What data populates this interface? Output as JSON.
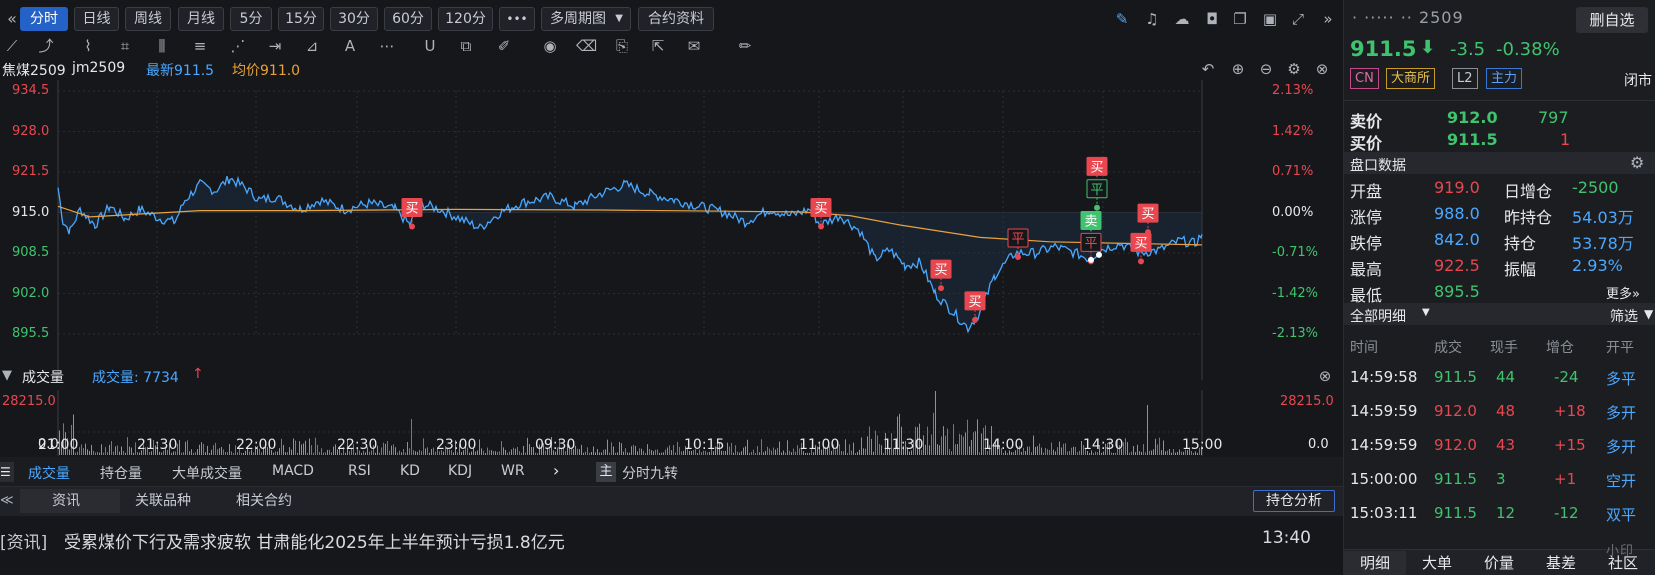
{
  "toolbar": {
    "tabs": [
      "分时",
      "日线",
      "周线",
      "月线",
      "5分",
      "15分",
      "30分",
      "60分",
      "120分"
    ],
    "more": "•••",
    "multi_period": "多周期图",
    "contract_info": "合约资料"
  },
  "chart_header": {
    "symbol": "焦煤2509",
    "code": "jm2509",
    "latest_label": "最新911.5",
    "avg_label": "均价911.0"
  },
  "price_axis_left": [
    "934.5",
    "928.0",
    "921.5",
    "915.0",
    "908.5",
    "902.0",
    "895.5"
  ],
  "price_axis_right": [
    "2.13%",
    "1.42%",
    "0.71%",
    "0.00%",
    "-0.71%",
    "-1.42%",
    "-2.13%"
  ],
  "volume_panel": {
    "title": "成交量",
    "value_label": "成交量: 7734",
    "max_left": "28215.0",
    "min_left": "0.0",
    "max_right": "28215.0",
    "min_right": "0.0"
  },
  "time_axis": [
    "21:00",
    "21:30",
    "22:00",
    "22:30",
    "23:00",
    "09:30",
    "10:15",
    "11:00",
    "11:30",
    "14:00",
    "14:30",
    "15:00"
  ],
  "trade_marks": [
    "买",
    "买",
    "买",
    "买",
    "买",
    "平",
    "买",
    "卖",
    "平",
    "平",
    "买",
    "买"
  ],
  "indicator_tabs": [
    "成交量",
    "持仓量",
    "大单成交量",
    "MACD",
    "RSI",
    "KD",
    "KDJ",
    "WR"
  ],
  "indicator_extra": {
    "badge": "主",
    "label": "分时九转"
  },
  "news_tabs": [
    "资讯",
    "关联品种",
    "相关合约"
  ],
  "news_button": "持仓分析",
  "news": {
    "tag": "[资讯]",
    "headline": "受累煤价下行及需求疲软 甘肃能化2025年上半年预计亏损1.8亿元",
    "time": "13:40"
  },
  "quote": {
    "name_masked": "· ·····   ·· 2509",
    "remove_button": "删自选",
    "price": "911.5",
    "change": "-3.5",
    "change_pct": "-0.38%",
    "badges": [
      "CN",
      "大商所",
      "L2",
      "主力"
    ],
    "status": "闭市",
    "ask_label": "卖价",
    "ask_price": "912.0",
    "ask_vol": "797",
    "bid_label": "买价",
    "bid_price": "911.5",
    "bid_vol": "1"
  },
  "panel_title": "盘口数据",
  "stats": [
    {
      "l1": "开盘",
      "v1": "919.0",
      "l2": "日增仓",
      "v2": "-2500"
    },
    {
      "l1": "涨停",
      "v1": "988.0",
      "l2": "昨持仓",
      "v2": "54.03万"
    },
    {
      "l1": "跌停",
      "v1": "842.0",
      "l2": "持仓",
      "v2": "53.78万"
    },
    {
      "l1": "最高",
      "v1": "922.5",
      "l2": "振幅",
      "v2": "2.93%"
    },
    {
      "l1": "最低",
      "v1": "895.5",
      "l2": "",
      "v2": ""
    }
  ],
  "more_link": "更多»",
  "detail": {
    "title": "全部明细",
    "filter": "筛选",
    "headers": [
      "时间",
      "成交",
      "现手",
      "增仓",
      "开平"
    ],
    "rows": [
      {
        "t": "14:59:58",
        "p": "911.5",
        "v": "44",
        "d": "-24",
        "k": "多平"
      },
      {
        "t": "14:59:59",
        "p": "912.0",
        "v": "48",
        "d": "+18",
        "k": "多开"
      },
      {
        "t": "14:59:59",
        "p": "912.0",
        "v": "43",
        "d": "+15",
        "k": "多开"
      },
      {
        "t": "15:00:00",
        "p": "911.5",
        "v": "3",
        "d": "+1",
        "k": "空开"
      },
      {
        "t": "15:03:11",
        "p": "911.5",
        "v": "12",
        "d": "-12",
        "k": "双平"
      }
    ]
  },
  "bottom_tabs": [
    "明细",
    "大单",
    "价量",
    "基差",
    "社区"
  ],
  "colors": {
    "up": "#e8474f",
    "down": "#3fc36e",
    "price_line": "#4aa8ff",
    "avg_line": "#e8a23c",
    "accent": "#2462c8"
  }
}
